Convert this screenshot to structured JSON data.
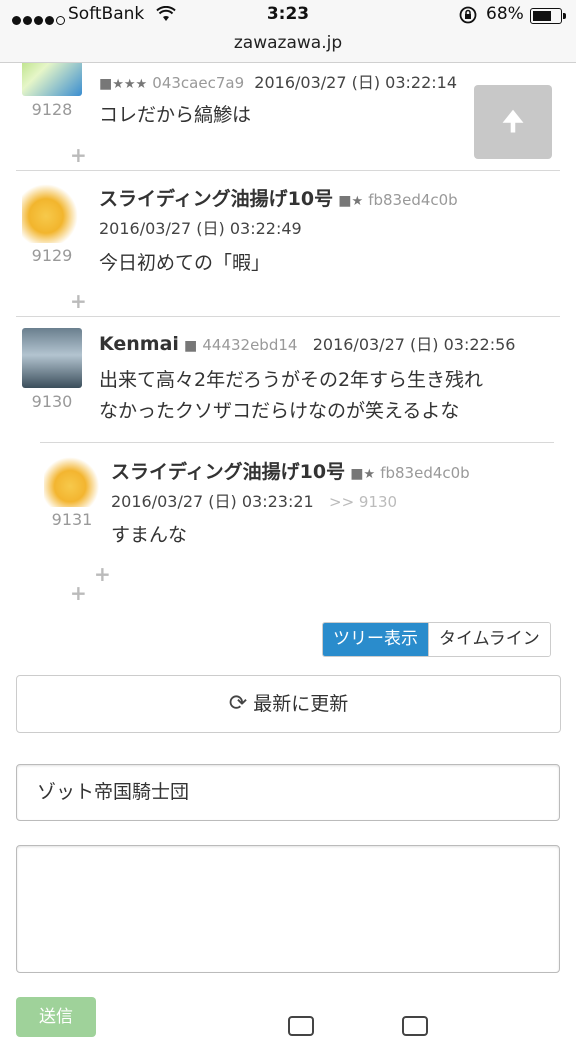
{
  "status_bar": {
    "carrier": "SoftBank",
    "time": "3:23",
    "battery": "68%"
  },
  "url": "zawazawa.jp",
  "comments": [
    {
      "number": "9128",
      "user_hash": "043caec7a9",
      "date": "2016/03/27 (日) 03:22:14",
      "body": "コレだから縞鯵は"
    },
    {
      "number": "9129",
      "name": "スライディング油揚げ10号",
      "user_hash": "fb83ed4c0b",
      "date": "2016/03/27 (日) 03:22:49",
      "body": "今日初めての「暇」"
    },
    {
      "number": "9130",
      "name": "Kenmai",
      "user_hash": "44432ebd14",
      "date": "2016/03/27 (日) 03:22:56",
      "body_line1": "出来て高々2年だろうがその2年すら生き残れ",
      "body_line2": "なかったクソザコだらけなのが笑えるよな"
    },
    {
      "number": "9131",
      "name": "スライディング油揚げ10号",
      "user_hash": "fb83ed4c0b",
      "date": "2016/03/27 (日) 03:23:21",
      "reply_to": ">> 9130",
      "body": "すまんな"
    }
  ],
  "view_toggle": {
    "tree": "ツリー表示",
    "timeline": "タイムライン"
  },
  "refresh_button": "最新に更新",
  "name_field": {
    "value": "ゾット帝国騎士団"
  },
  "send_button": "送信",
  "colors": {
    "accent": "#2a8ccc",
    "send_button": "#9fd29a"
  }
}
